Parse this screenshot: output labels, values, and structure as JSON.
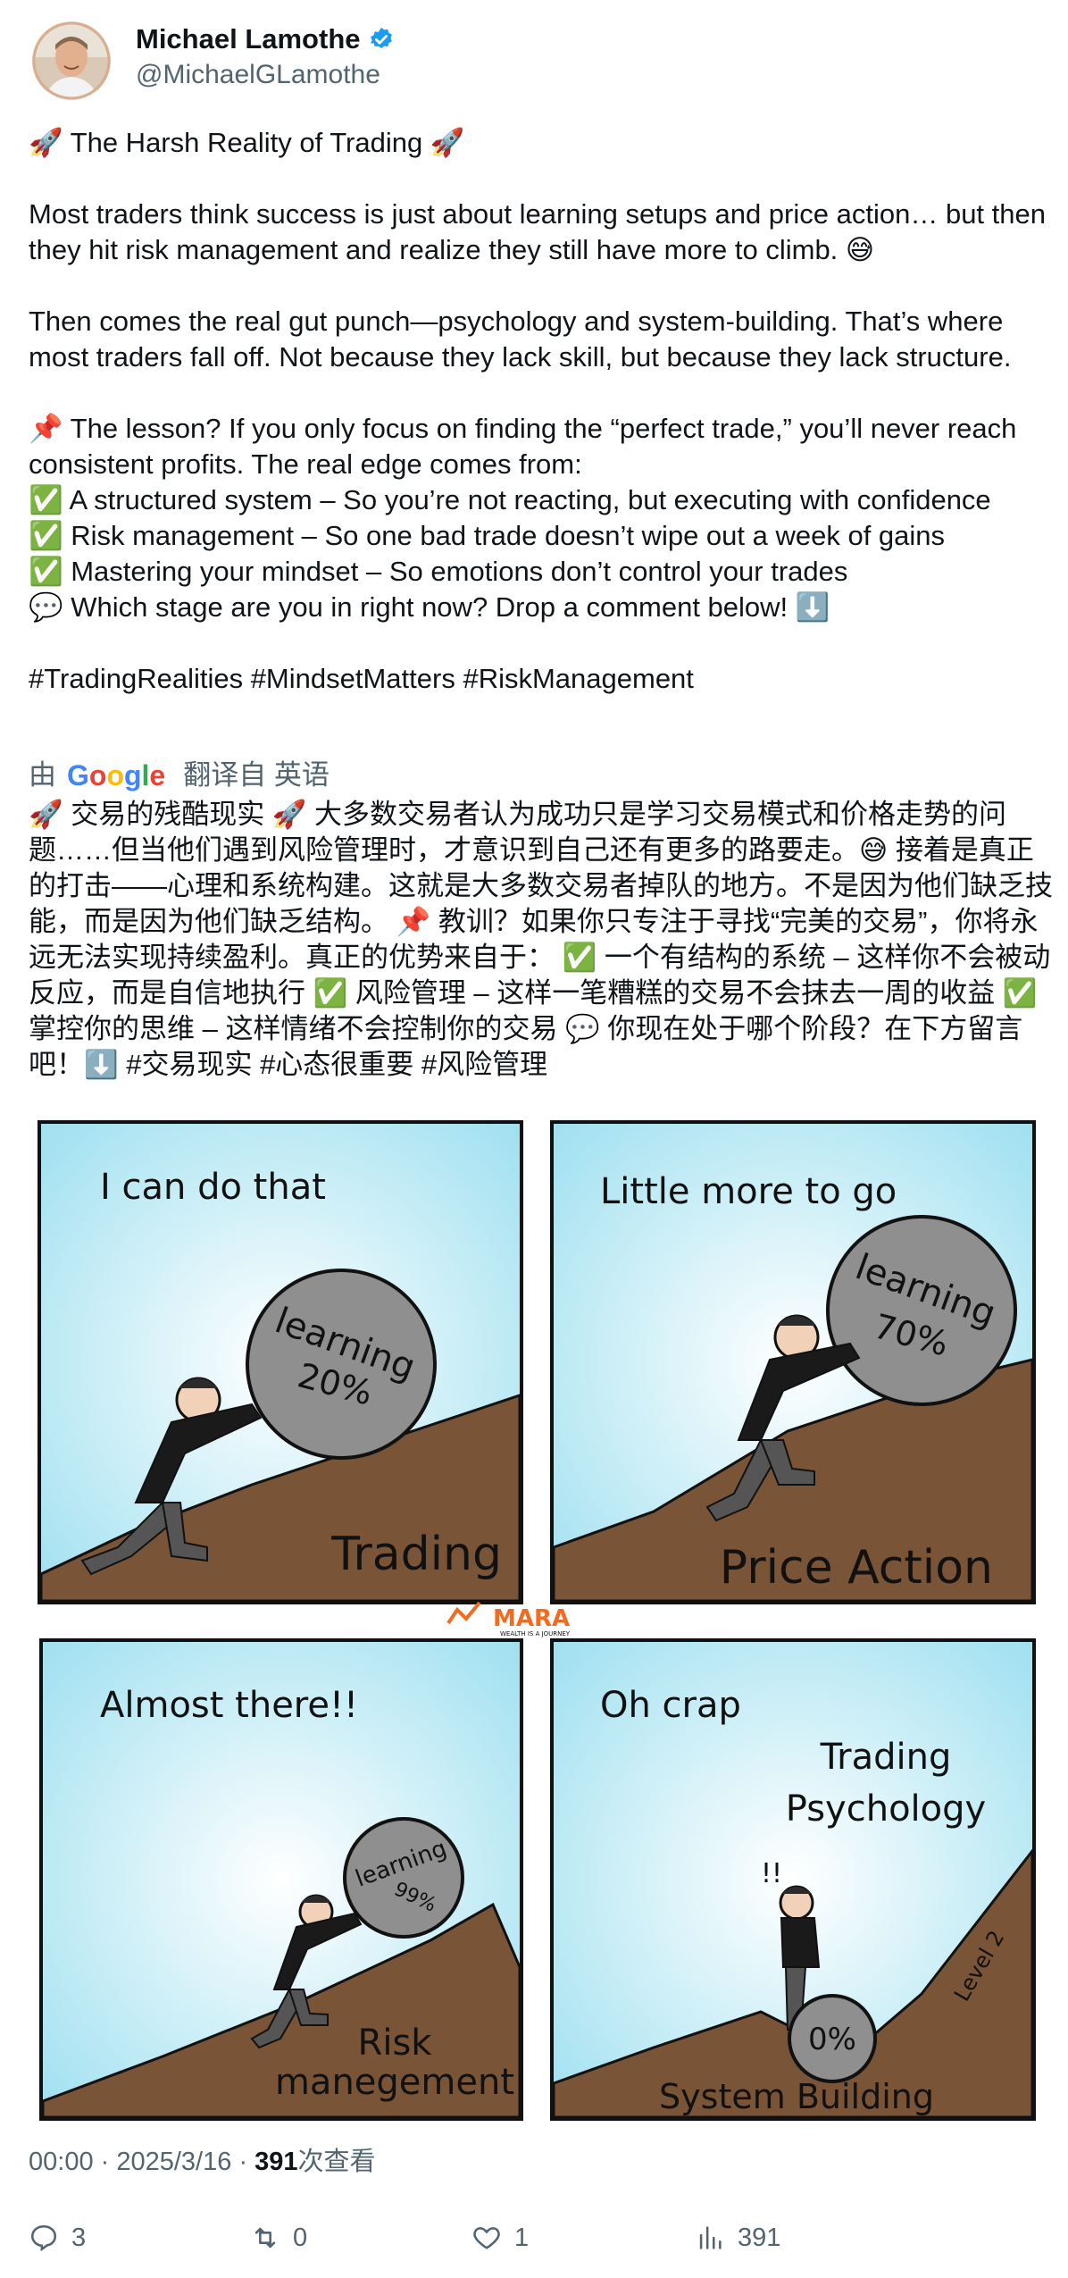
{
  "author": {
    "name": "Michael Lamothe",
    "handle": "@MichaelGLamothe",
    "verified": true
  },
  "tweet": {
    "lines": [
      "🚀 The Harsh Reality of Trading 🚀",
      "",
      "Most traders think success is just about learning setups and price action… but then they hit risk management and realize they still have more to climb. 😅",
      "",
      "Then comes the real gut punch—psychology and system-building. That’s where most traders fall off. Not because they lack skill, but because they lack structure.",
      "",
      "📌 The lesson? If you only focus on finding the “perfect trade,” you’ll never reach consistent profits. The real edge comes from:",
      "✅ A structured system – So you’re not reacting, but executing with confidence",
      "✅ Risk management – So one bad trade doesn’t wipe out a week of gains",
      "✅ Mastering your mindset – So emotions don’t control your trades",
      "💬 Which stage are you in right now? Drop a comment below! ⬇️",
      "",
      "#TradingRealities #MindsetMatters #RiskManagement"
    ]
  },
  "translation": {
    "prefix": "由",
    "provider": "Google",
    "suffix": "翻译自 英语",
    "text": "🚀 交易的残酷现实 🚀 大多数交易者认为成功只是学习交易模式和价格走势的问题……但当他们遇到风险管理时，才意识到自己还有更多的路要走。😅 接着是真正的打击——心理和系统构建。这就是大多数交易者掉队的地方。不是因为他们缺乏技能，而是因为他们缺乏结构。 📌 教训？如果你只专注于寻找“完美的交易”，你将永远无法实现持续盈利。真正的优势来自于： ✅ 一个有结构的系统 – 这样你不会被动反应，而是自信地执行 ✅ 风险管理 – 这样一笔糟糕的交易不会抹去一周的收益 ✅ 掌控你的思维 – 这样情绪不会控制你的交易 💬 你现在处于哪个阶段？在下方留言吧！⬇️ #交易现实 #心态很重要 #风险管理"
  },
  "comic": {
    "panels": [
      {
        "speech": "I can do that",
        "boulder": [
          "learning",
          "20%"
        ],
        "caption": [
          "Trading"
        ]
      },
      {
        "speech": "Little more to go",
        "boulder": [
          "learning",
          "70%"
        ],
        "caption": [
          "Price Action"
        ]
      },
      {
        "speech": "Almost there!!",
        "boulder": [
          "learning",
          "99%"
        ],
        "caption": [
          "Risk",
          "manegement"
        ]
      },
      {
        "speech": "Oh crap",
        "boulder": [
          "0%"
        ],
        "caption": [
          "System Building"
        ],
        "extra": [
          "Trading",
          "Psychology"
        ],
        "slope_label": "Level 2"
      }
    ],
    "watermark": "MARA",
    "watermark_sub": "WEALTH IS A JOURNEY",
    "colors": {
      "sky": "#c9eef7",
      "ground": "#7a5436",
      "boulder": "#8f8f8f",
      "border": "#111111",
      "accent": "#f26b21"
    }
  },
  "meta": {
    "time": "00:00",
    "date": "2025/3/16",
    "views_count": "391",
    "views_label": "次查看"
  },
  "actions": {
    "replies": "3",
    "reposts": "0",
    "likes": "1",
    "views": "391"
  },
  "colors": {
    "text": "#0f1419",
    "secondary": "#536471",
    "verified": "#1d9bf0"
  }
}
